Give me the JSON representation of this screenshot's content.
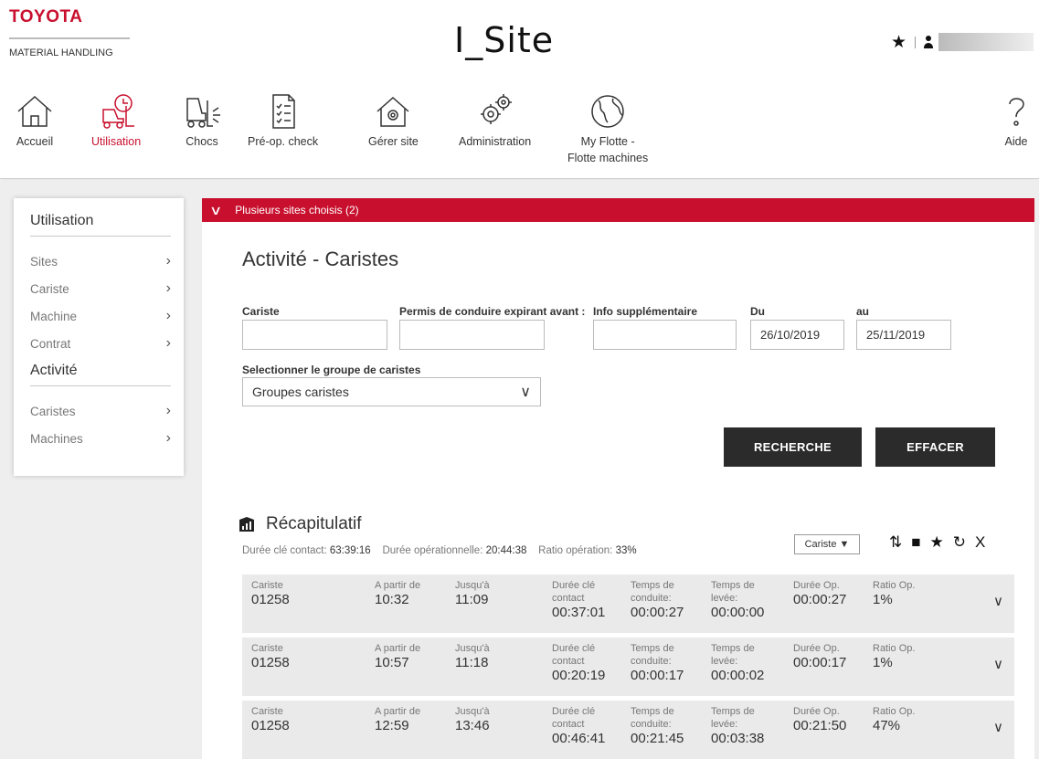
{
  "header": {
    "brand_name": "TOYOTA",
    "brand_sub": "MATERIAL HANDLING",
    "app_title": "I_Site"
  },
  "nav": [
    {
      "label": "Accueil",
      "icon": "home-icon"
    },
    {
      "label": "Utilisation",
      "icon": "forklift-clock-icon"
    },
    {
      "label": "Chocs",
      "icon": "forklift-impact-icon"
    },
    {
      "label": "Pré-op. check",
      "icon": "checklist-icon"
    },
    {
      "label": "Gérer site",
      "icon": "house-gear-icon"
    },
    {
      "label": "Administration",
      "icon": "gears-icon"
    },
    {
      "label": "My Flotte -",
      "label2": "Flotte machines",
      "icon": "globe-icon"
    },
    {
      "label": "Aide",
      "icon": "question-icon"
    }
  ],
  "sidebar": {
    "utilisation_title": "Utilisation",
    "utilisation_items": [
      "Sites",
      "Cariste",
      "Machine",
      "Contrat"
    ],
    "activite_title": "Activité",
    "activite_items": [
      "Caristes",
      "Machines"
    ]
  },
  "main": {
    "sites_bar": "Plusieurs sites choisis (2)",
    "page_title": "Activité - Caristes",
    "filters": {
      "cariste_label": "Cariste",
      "cariste_value": "",
      "permis_label": "Permis de conduire expirant avant :",
      "permis_value": "",
      "info_label": "Info supplémentaire",
      "info_value": "",
      "du_label": "Du",
      "du_value": "26/10/2019",
      "au_label": "au",
      "au_value": "25/11/2019",
      "group_label": "Selectionner le groupe de caristes",
      "group_value": "Groupes caristes"
    },
    "buttons": {
      "search": "RECHERCHE",
      "clear": "EFFACER"
    },
    "recap": {
      "title": "Récapitulatif",
      "contact_label": "Durée clé contact:",
      "contact_value": "63:39:16",
      "oper_label": "Durée opérationnelle:",
      "oper_value": "20:44:38",
      "ratio_label": "Ratio opération:",
      "ratio_value": "33%",
      "sort_dropdown": "Cariste"
    },
    "row_labels": {
      "cariste": "Cariste",
      "from": "A partir de",
      "to": "Jusqu'à",
      "contact_1": "Durée clé",
      "contact_2": "contact",
      "drive_1": "Temps de",
      "drive_2": "conduite:",
      "lift_1": "Temps de",
      "lift_2": "levée:",
      "op": "Durée Op.",
      "ratio": "Ratio Op."
    },
    "rows": [
      {
        "cariste": "01258",
        "from": "10:32",
        "to": "11:09",
        "contact": "00:37:01",
        "drive": "00:00:27",
        "lift": "00:00:00",
        "op": "00:00:27",
        "ratio": "1%"
      },
      {
        "cariste": "01258",
        "from": "10:57",
        "to": "11:18",
        "contact": "00:20:19",
        "drive": "00:00:17",
        "lift": "00:00:02",
        "op": "00:00:17",
        "ratio": "1%"
      },
      {
        "cariste": "01258",
        "from": "12:59",
        "to": "13:46",
        "contact": "00:46:41",
        "drive": "00:21:45",
        "lift": "00:03:38",
        "op": "00:21:50",
        "ratio": "47%"
      }
    ]
  },
  "colors": {
    "brand_red": "#c8102e",
    "dark_button": "#2b2b2b",
    "row_bg": "#eaeaea"
  }
}
